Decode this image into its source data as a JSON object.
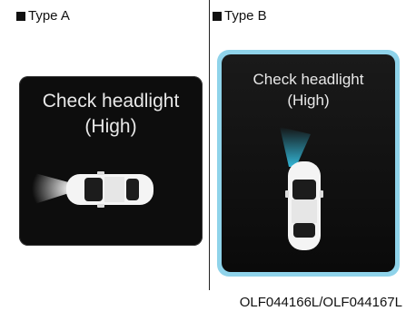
{
  "panels": [
    {
      "label": "Type A",
      "message_line1": "Check headlight",
      "message_line2": "(High)"
    },
    {
      "label": "Type B",
      "message_line1": "Check headlight",
      "message_line2": "(High)"
    }
  ],
  "figure_code": "OLF044166L/OLF044167L",
  "colors": {
    "screen_bg": "#0d0d0d",
    "beam_a": "#ffffff",
    "beam_b": "#33b6d6",
    "frame_b": "#8fd3ea"
  },
  "icons": [
    "car-top-view-icon",
    "headlight-beam-icon"
  ]
}
